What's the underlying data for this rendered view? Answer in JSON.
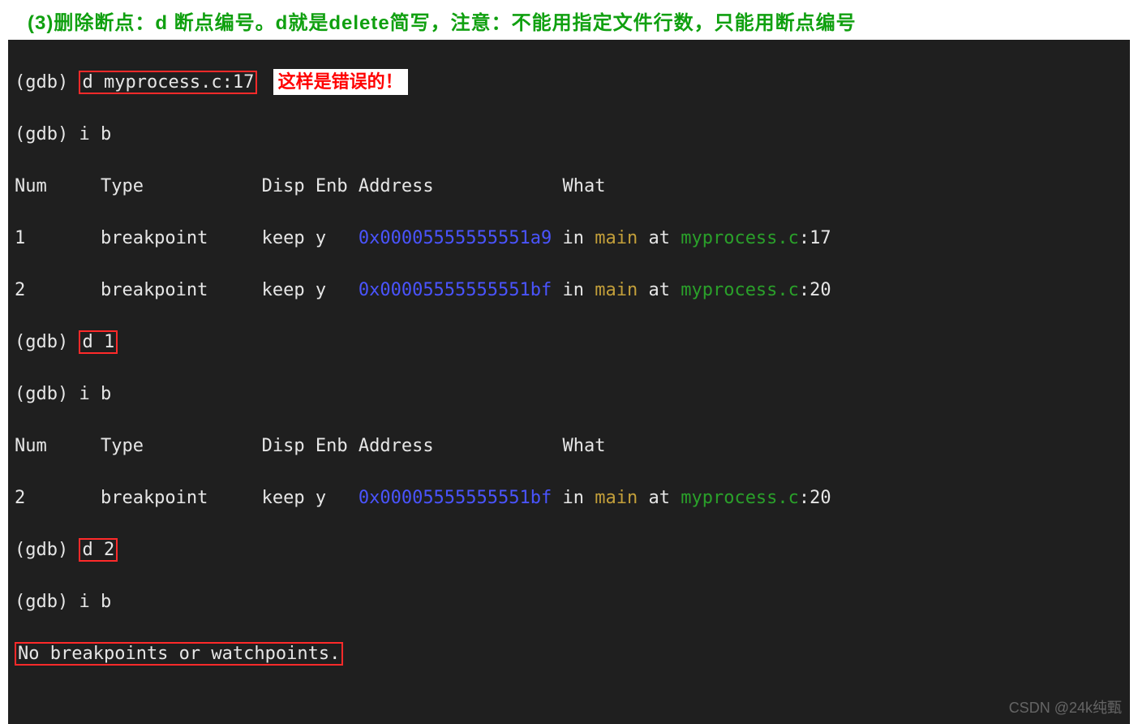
{
  "heading": "(3)删除断点：d 断点编号。d就是delete简写，注意：不能用指定文件行数，只能用断点编号",
  "callout": "这样是错误的！",
  "watermark": "CSDN @24k纯甄",
  "term": {
    "l1_prompt": "(gdb) ",
    "l1_cmd": "d myprocess.c:17",
    "l2": "(gdb) i b",
    "hdr": "Num     Type           Disp Enb Address            What",
    "bp1_pre": "1       breakpoint     keep y   ",
    "bp1_addr": "0x00005555555551a9",
    "bp1_in": " in ",
    "bp1_fn": "main",
    "bp1_at": " at ",
    "bp1_file": "myprocess.c",
    "bp1_line": ":17",
    "bp2_pre": "2       breakpoint     keep y   ",
    "bp2_addr": "0x00005555555551bf",
    "bp2_in": " in ",
    "bp2_fn": "main",
    "bp2_at": " at ",
    "bp2_file": "myprocess.c",
    "bp2_line": ":20",
    "l6_prompt": "(gdb) ",
    "l6_cmd": "d 1",
    "l7": "(gdb) i b",
    "hdr2": "Num     Type           Disp Enb Address            What",
    "bp3_pre": "2       breakpoint     keep y   ",
    "bp3_addr": "0x00005555555551bf",
    "bp3_in": " in ",
    "bp3_fn": "main",
    "bp3_at": " at ",
    "bp3_file": "myprocess.c",
    "bp3_line": ":20",
    "l10_prompt": "(gdb) ",
    "l10_cmd": "d 2",
    "l11": "(gdb) i b",
    "l12": "No breakpoints or watchpoints."
  }
}
